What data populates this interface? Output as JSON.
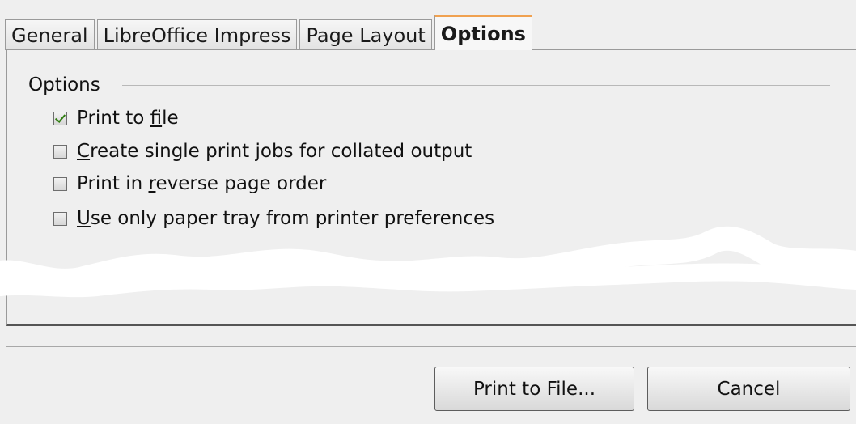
{
  "tabs": [
    {
      "label": "General"
    },
    {
      "label": "LibreOffice Impress"
    },
    {
      "label": "Page Layout"
    },
    {
      "label": "Options",
      "active": true
    }
  ],
  "options_group": {
    "heading": "Options",
    "items": [
      {
        "before": "Print to ",
        "mnemonic": "f",
        "after": "ile",
        "checked": true
      },
      {
        "before": "",
        "mnemonic": "C",
        "after": "reate single print jobs for collated output",
        "checked": false
      },
      {
        "before": "Print in ",
        "mnemonic": "r",
        "after": "everse page order",
        "checked": false
      },
      {
        "before": "",
        "mnemonic": "U",
        "after": "se only paper tray from printer preferences",
        "checked": false
      }
    ]
  },
  "buttons": {
    "print_to_file": "Print to File...",
    "cancel": "Cancel"
  },
  "colors": {
    "background": "#efefef",
    "active_tab_accent": "#f0a150",
    "check_mark": "#2f7d10",
    "redaction_scribble": "#ffffff"
  }
}
